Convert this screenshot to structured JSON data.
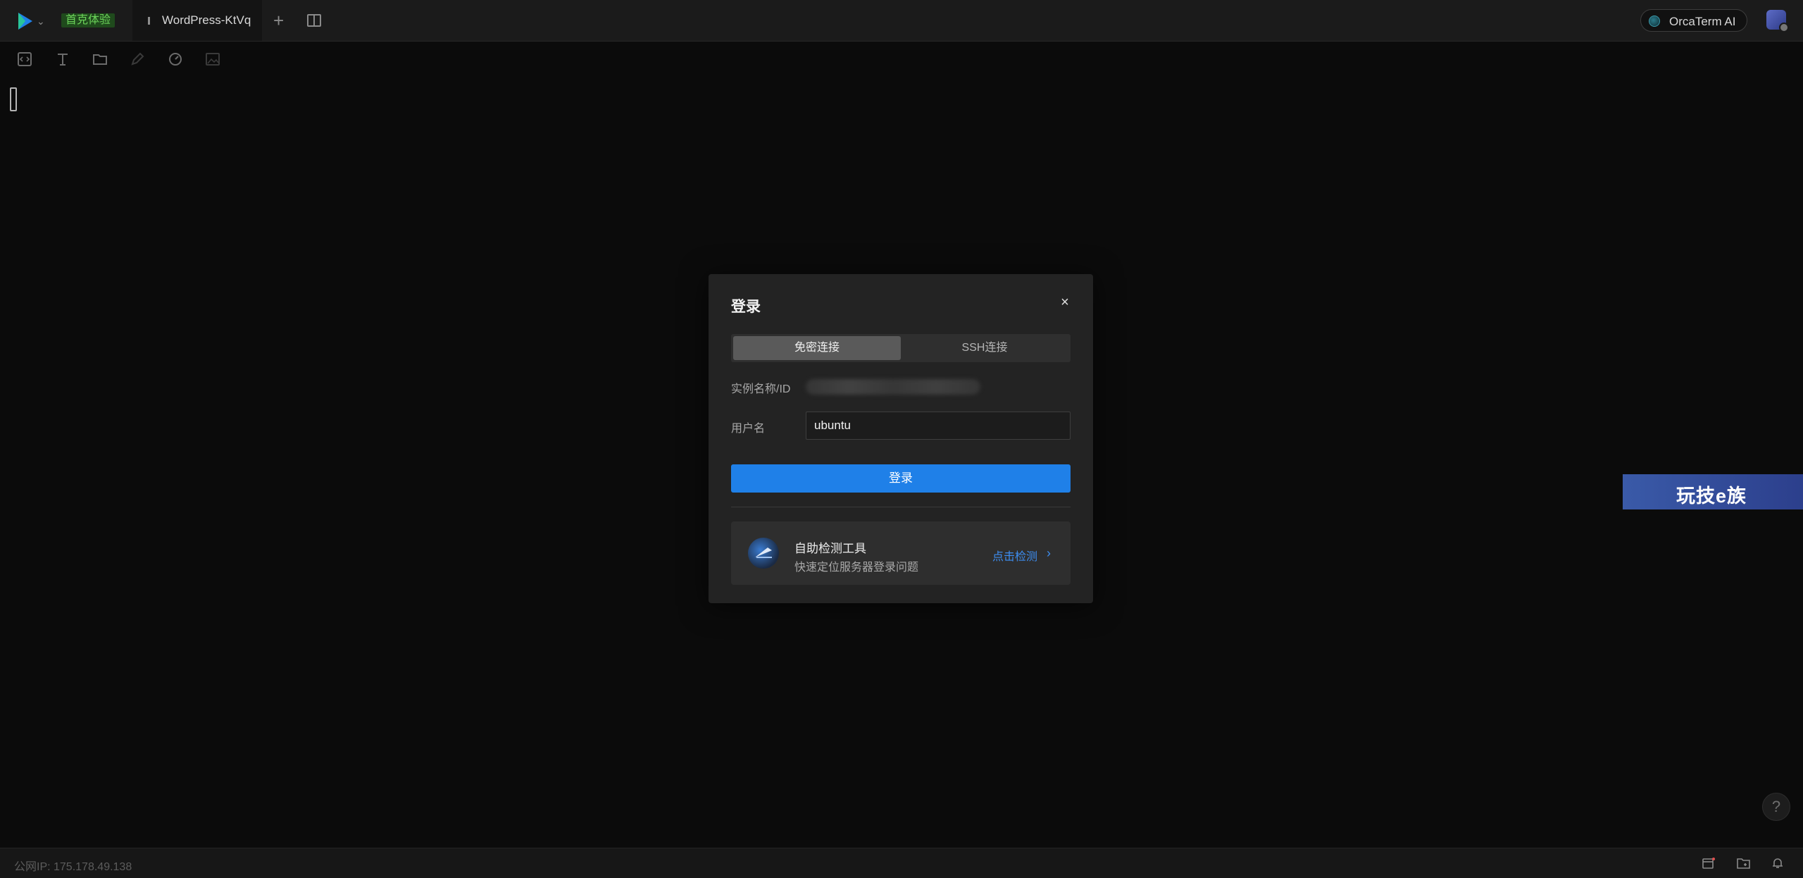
{
  "topbar": {
    "badge": "首克体验",
    "tab_label": "WordPress-KtVq",
    "add_tab": "+",
    "ai_button": "OrcaTerm AI"
  },
  "dialog": {
    "title": "登录",
    "close": "×",
    "tabs": [
      "免密连接",
      "SSH连接"
    ],
    "instance_label": "实例名称/ID",
    "username_label": "用户名",
    "username_value": "ubuntu",
    "login_button": "登录",
    "tool": {
      "title": "自助检测工具",
      "description": "快速定位服务器登录问题",
      "link": "点击检测",
      "chevron": "›"
    }
  },
  "watermark": "玩技e族",
  "help": "?",
  "status": {
    "ip": "公网IP: 175.178.49.138"
  },
  "colors": {
    "accent": "#1f80e8",
    "link": "#3d8df0",
    "badge_bg": "#1f4a1c",
    "badge_text": "#6cd35a"
  }
}
